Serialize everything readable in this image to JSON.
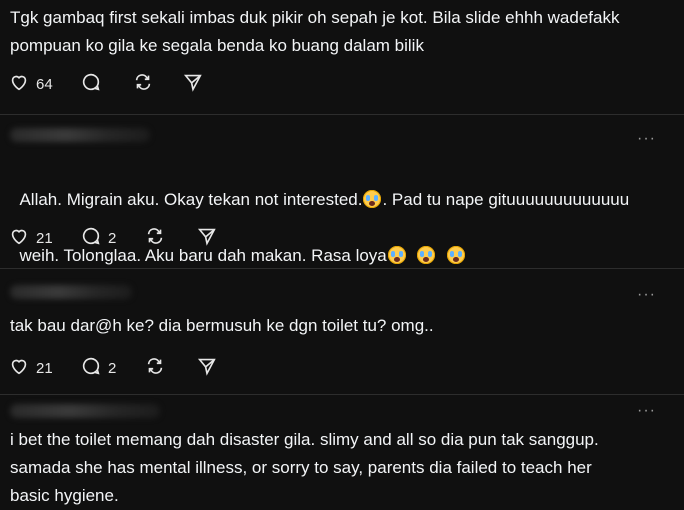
{
  "posts": [
    {
      "text": "Tgk gambaq first sekali imbas duk pikir oh sepah je kot. Bila slide ehhh wadefakk\npompuan ko gila ke segala benda ko buang dalam bilik",
      "likes": "64",
      "replies": ""
    },
    {
      "text_a": "Allah. Migrain aku. Okay tekan not interested.",
      "text_b": ". Pad tu nape gituuuuuuuuuuuuu",
      "text_c": "weih. Tolonglaa. Aku baru dah makan. Rasa loya",
      "likes": "21",
      "replies": "2",
      "more": "···"
    },
    {
      "text": "tak bau dar@h ke? dia bermusuh ke dgn toilet tu? omg..",
      "likes": "21",
      "replies": "2",
      "more": "···"
    },
    {
      "text": "i bet the toilet memang dah disaster gila. slimy and all so dia pun tak sanggup.\nsamada she has mental illness, or sorry to say, parents dia failed to teach her\nbasic hygiene.",
      "more": "···"
    }
  ],
  "icons": [
    "heart-icon",
    "comment-icon",
    "repost-icon",
    "share-icon",
    "crying-face-emoji"
  ],
  "colors": {
    "background": "#101010",
    "text": "#f3f5f7",
    "divider": "#2d2d2d",
    "muted": "#9a9a9a"
  }
}
